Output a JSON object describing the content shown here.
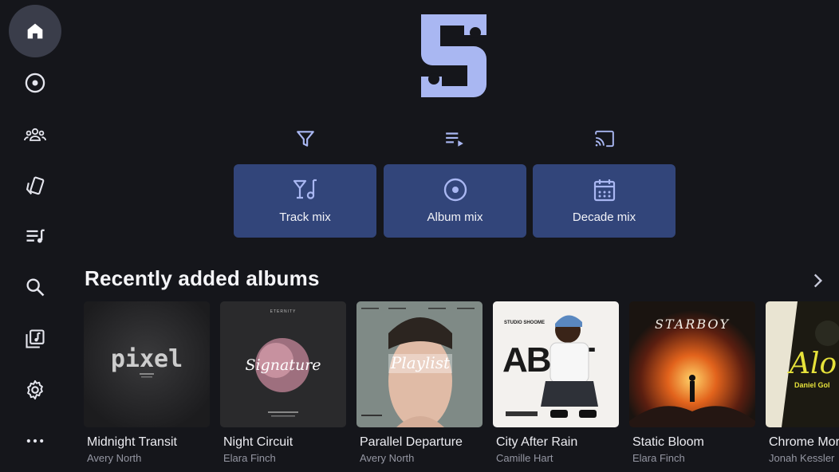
{
  "colors": {
    "background": "#15161b",
    "accent": "#a9b7f2",
    "mix_card": "#32457a",
    "active_nav": "#3a3d4a"
  },
  "sidebar": {
    "items": [
      {
        "icon": "home-icon",
        "active": true
      },
      {
        "icon": "album-disc-icon"
      },
      {
        "icon": "artists-group-icon"
      },
      {
        "icon": "genres-cards-icon"
      },
      {
        "icon": "playlists-icon"
      },
      {
        "icon": "search-icon"
      },
      {
        "icon": "library-icon"
      },
      {
        "icon": "settings-icon"
      },
      {
        "icon": "more-icon"
      }
    ]
  },
  "toolbar": {
    "icons": [
      "filter-icon",
      "queue-icon",
      "cast-icon"
    ]
  },
  "mixes": [
    {
      "label": "Track mix",
      "icon": "cocktail-music-icon"
    },
    {
      "label": "Album mix",
      "icon": "disc-icon"
    },
    {
      "label": "Decade mix",
      "icon": "calendar-icon"
    }
  ],
  "recent": {
    "title": "Recently added albums",
    "albums": [
      {
        "title": "Midnight Transit",
        "artist": "Avery North",
        "cover_text": "pixel"
      },
      {
        "title": "Night Circuit",
        "artist": "Elara Finch",
        "cover_text": "Signature",
        "cover_top": "ETERNITY"
      },
      {
        "title": "Parallel Departure",
        "artist": "Avery North",
        "cover_text": "Playlist"
      },
      {
        "title": "City After Rain",
        "artist": "Camille Hart",
        "cover_text": "ABUT",
        "cover_top": "STUDIO SHOOME"
      },
      {
        "title": "Static Bloom",
        "artist": "Elara Finch",
        "cover_text": "STARBOY"
      },
      {
        "title": "Chrome Morning",
        "artist": "Jonah Kessler",
        "cover_text": "Alo",
        "cover_sub": "Daniel Gol"
      }
    ]
  }
}
